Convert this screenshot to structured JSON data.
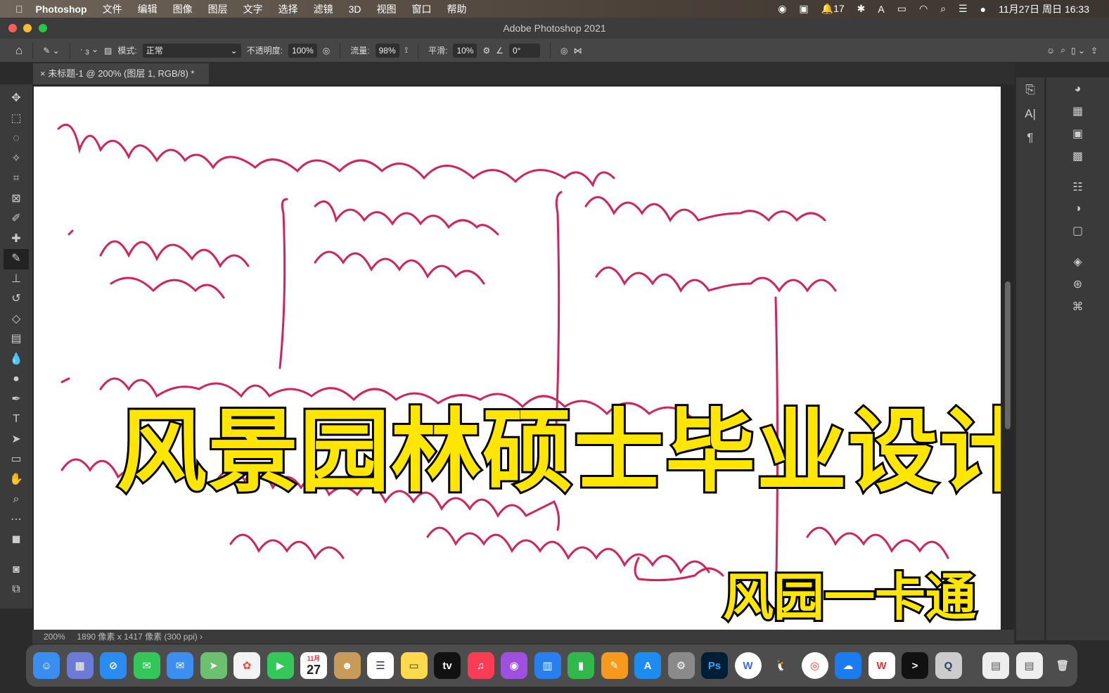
{
  "menubar": {
    "app": "Photoshop",
    "items": [
      "文件",
      "编辑",
      "图像",
      "图层",
      "文字",
      "选择",
      "滤镜",
      "3D",
      "视图",
      "窗口",
      "帮助"
    ],
    "notification_count": "17",
    "datetime": "11月27日 周日 16:33"
  },
  "window": {
    "title": "Adobe Photoshop 2021"
  },
  "options": {
    "mode_label": "模式:",
    "mode_value": "正常",
    "opacity_label": "不透明度:",
    "opacity_value": "100%",
    "flow_label": "流量:",
    "flow_value": "98%",
    "smooth_label": "平滑:",
    "smooth_value": "10%",
    "angle_value": "0°",
    "brush_size": "3"
  },
  "document": {
    "tab_title": "未标题-1 @ 200% (图层 1, RGB/8) *"
  },
  "status": {
    "zoom": "200%",
    "dimensions": "1890 像素 x 1417 像素 (300 ppi)"
  },
  "overlay": {
    "title": "风景园林硕士毕业设计",
    "logo": "风园一卡通"
  },
  "colors": {
    "ink": "#d0245a",
    "overlay_text": "#ffe600"
  },
  "dock": {
    "calendar_month": "11月",
    "calendar_day": "27",
    "ps_label": "Ps",
    "tv_label": "tv"
  }
}
